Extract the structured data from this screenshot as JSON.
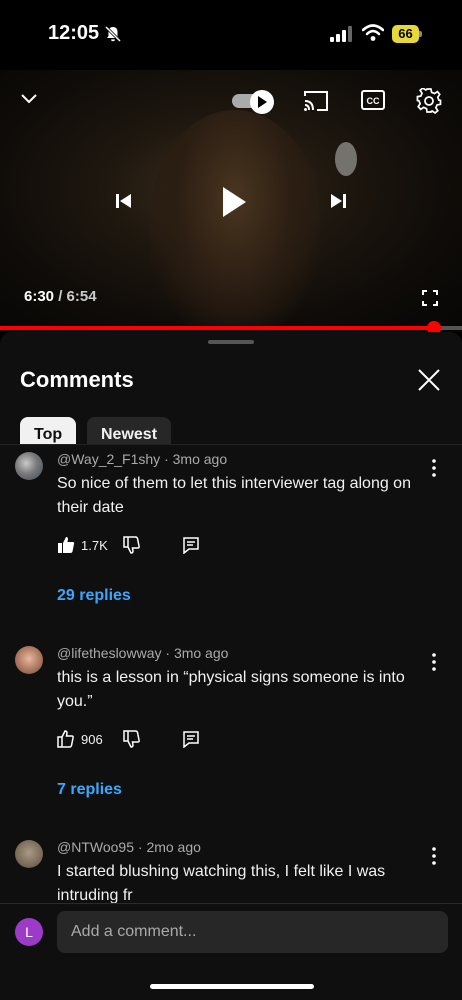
{
  "status_bar": {
    "time": "12:05",
    "battery": "66",
    "icons": [
      "bell-off-icon",
      "signal-icon",
      "wifi-icon",
      "battery-icon"
    ]
  },
  "player": {
    "current_time": "6:30",
    "separator": " / ",
    "duration": "6:54",
    "progress_fraction": 0.94,
    "icons": [
      "chevron-down-icon",
      "autoplay-toggle-icon",
      "cast-icon",
      "cc-icon",
      "settings-icon",
      "previous-icon",
      "play-icon",
      "next-icon",
      "fullscreen-icon"
    ]
  },
  "comments_panel": {
    "title": "Comments",
    "filters": [
      {
        "label": "Top",
        "selected": true
      },
      {
        "label": "Newest",
        "selected": false
      }
    ]
  },
  "comments": [
    {
      "author": "@Way_2_F1shy",
      "age": "3mo ago",
      "text": "So nice of them to let this interviewer tag along on their date",
      "likes": "1.7K",
      "liked": true,
      "replies": "29 replies"
    },
    {
      "author": "@lifetheslowway",
      "age": "3mo ago",
      "text": "this is a lesson in “physical signs someone is into you.”",
      "likes": "906",
      "liked": false,
      "replies": "7 replies"
    },
    {
      "author": "@NTWoo95",
      "age": "2mo ago",
      "text": "I started blushing watching this, I felt like I was intruding fr"
    }
  ],
  "composer": {
    "avatar_initial": "L",
    "placeholder": "Add a comment..."
  },
  "colors": {
    "accent_red": "#ff0000",
    "link_blue": "#3ea6ff",
    "panel_bg": "#0f0f0f",
    "avatar_purple": "#9c3bc7",
    "battery_yellow": "#e6d83a"
  }
}
